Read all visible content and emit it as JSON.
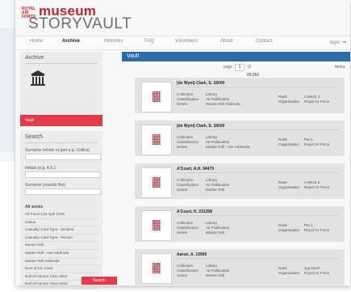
{
  "brand": {
    "small": "ROYAL AIR FORCE",
    "museum": "museum",
    "story": "STORYVAULT"
  },
  "nav": [
    {
      "label": "Home",
      "active": false
    },
    {
      "label": "Archive",
      "active": true
    },
    {
      "label": "Histories",
      "active": false
    },
    {
      "label": "FAQ",
      "active": false
    },
    {
      "label": "Volunteers",
      "active": false
    },
    {
      "label": "About",
      "active": false
    },
    {
      "label": "Contact",
      "active": false
    }
  ],
  "login": "login",
  "sidebar": {
    "archive_title": "Archive",
    "vault_label": "Vault",
    "search_title": "Search",
    "surname_label": "Surname (whole or part e.g. Collins)",
    "initials_label": "Initials (e.g. A.E.)",
    "sounds_label": "Surname (sounds like)",
    "series_title": "All series",
    "series": [
      "Air Force List April 1918",
      "Casua",
      "Casualty Card Type - Incident",
      "Casualty Card Type - Person",
      "Muster Roll",
      "Muster Roll - see Addenda",
      "Muster Roll Addenda",
      "Next of Kin Card",
      "Roll of Honour 1911-1914",
      "Roll of Honour 1914-1918"
    ],
    "search_button": "Search"
  },
  "vault": {
    "title": "Vault",
    "page_label": "page",
    "page_value": "1",
    "page_of": "/2",
    "next_label": "next",
    "total": "29,952"
  },
  "records": [
    {
      "name": "(de Wynt) Clark, S. 16000",
      "collection": "Library",
      "classification": "Air Publication",
      "series": "Muster Roll Addenda",
      "rank": "A Mech 3",
      "organisation": "Royal Air Force"
    },
    {
      "name": "(de Wynt) Clark, S. 16000",
      "collection": "Library",
      "classification": "Air Publication",
      "series": "Muster Roll - see Addenda",
      "rank": "Pte 1",
      "organisation": "Royal Air Force"
    },
    {
      "name": "A'Court, A.H. 94479",
      "collection": "Library",
      "classification": "Air Publication",
      "series": "Muster Roll",
      "rank": "A Mech 3",
      "organisation": "Royal Air Force"
    },
    {
      "name": "A'Court, H. 231358",
      "collection": "Library",
      "classification": "Air Publication",
      "series": "Muster Roll",
      "rank": "Pte 1",
      "organisation": "Royal Air Force"
    },
    {
      "name": "Aaron, A. 10900",
      "collection": "Library",
      "classification": "Air Publication",
      "series": "Muster Roll",
      "rank": "Sgt Mech",
      "organisation": "Royal Air Force"
    }
  ],
  "field_labels": {
    "collection": "Collection",
    "classification": "Classification",
    "series": "Series",
    "rank": "Rank",
    "organisation": "Organisation"
  },
  "colors": {
    "brand_red": "#c1272d",
    "vault_red": "#e23b4a",
    "header_blue": "#2f6aa8"
  }
}
